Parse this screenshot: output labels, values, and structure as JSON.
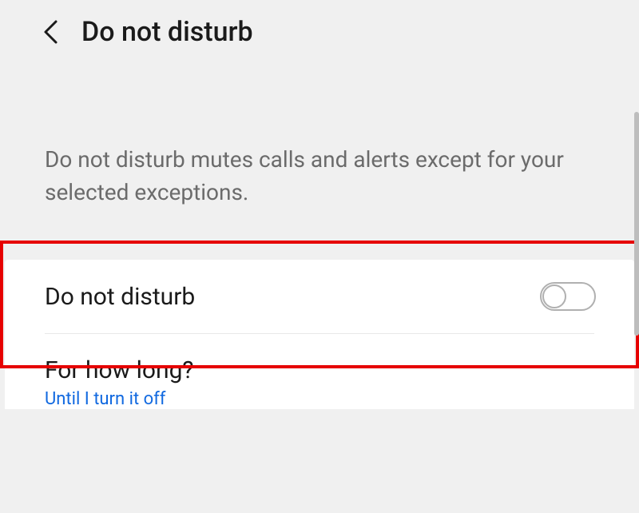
{
  "header": {
    "title": "Do not disturb"
  },
  "description": "Do not disturb mutes calls and alerts except for your selected exceptions.",
  "items": {
    "dnd": {
      "label": "Do not disturb"
    },
    "duration": {
      "label": "For how long?",
      "value": "Until I turn it off"
    }
  }
}
